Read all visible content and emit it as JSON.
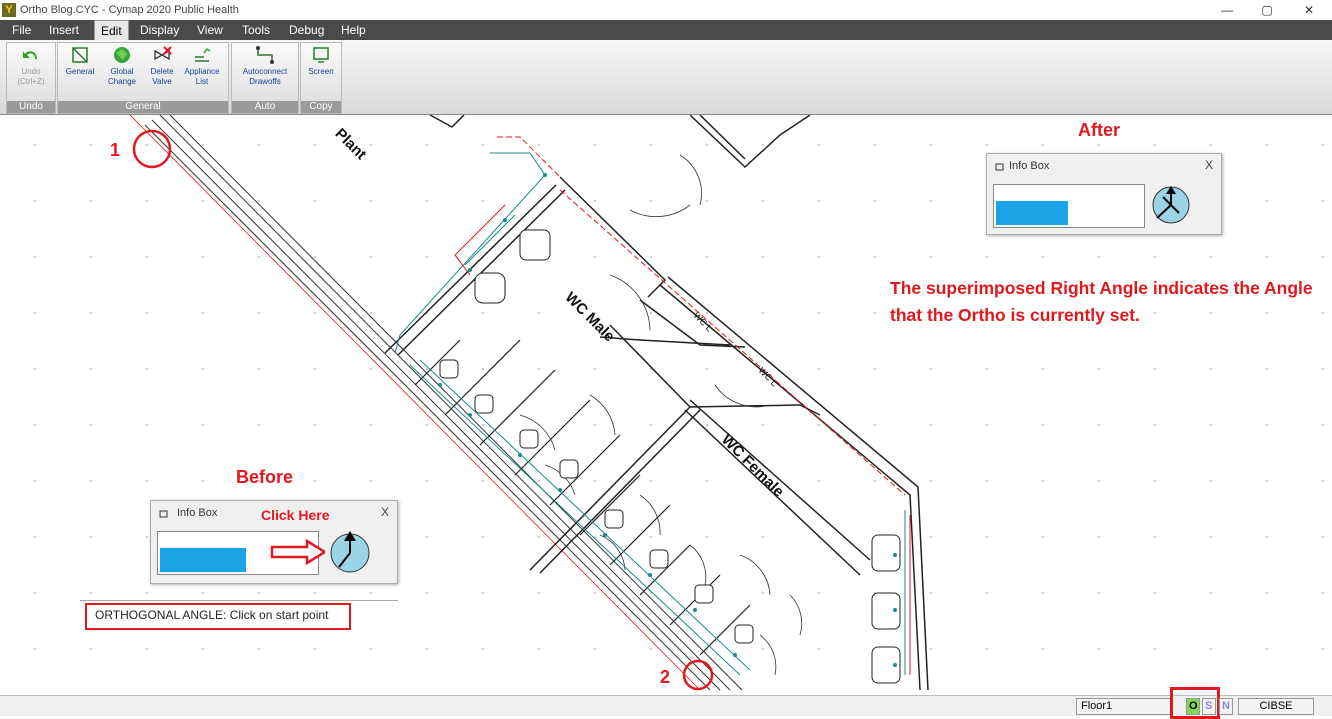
{
  "window": {
    "title": "Ortho Blog.CYC - Cymap 2020 Public Health",
    "app_icon": "Y",
    "minimize": "—",
    "restore": "▢",
    "close": "✕"
  },
  "menu": [
    "File",
    "Insert",
    "Edit",
    "Display",
    "View",
    "Tools",
    "Debug",
    "Help"
  ],
  "menu_active": "Edit",
  "ribbon": {
    "undo": {
      "label": "Undo (Ctrl+Z)",
      "group": "Undo"
    },
    "general": {
      "buttons": [
        {
          "label": "General",
          "icon": "general-icon"
        },
        {
          "label": "Global Change",
          "icon": "global-change-icon"
        },
        {
          "label": "Delete Valve",
          "icon": "delete-valve-icon"
        },
        {
          "label": "Appliance List",
          "icon": "appliance-list-icon"
        }
      ],
      "group": "General"
    },
    "auto": {
      "label": "Autoconnect Drawoffs",
      "group": "Auto"
    },
    "copy": {
      "label": "Screen",
      "group": "Copy"
    }
  },
  "drawing": {
    "room_plant": "Plant",
    "room_wc_male": "WC Male",
    "room_wc_female": "WC Female",
    "wc_l_1": "WC L",
    "wc_l_2": "WC L"
  },
  "annotations": {
    "point_1": "1",
    "point_2": "2",
    "after": "After",
    "before": "Before",
    "click_here": "Click Here",
    "note": "The superimposed Right Angle indicates the Angle that the Ortho is currently set."
  },
  "info_box_after": {
    "title": "Info Box",
    "close": "X"
  },
  "info_box_before": {
    "title": "Info Box",
    "close": "X"
  },
  "command_line": "ORTHOGONAL ANGLE: Click on start point",
  "status": {
    "floor": "Floor1",
    "toggle_o": "O",
    "toggle_s": "S",
    "toggle_n": "N",
    "standard": "CIBSE"
  },
  "colors": {
    "annotation_red": "#e0191e",
    "pipe_teal": "#1b8a8a",
    "pipe_red": "#e0191e",
    "info_bar_blue": "#1aa3e6",
    "compass_fill": "#9ad4e6"
  }
}
